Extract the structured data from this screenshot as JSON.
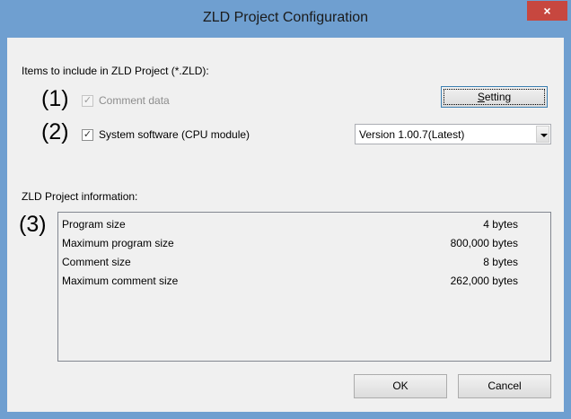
{
  "window": {
    "title": "ZLD Project Configuration",
    "close_glyph": "×"
  },
  "items_group": {
    "label": "Items to include in ZLD Project (*.ZLD):",
    "comment_data": {
      "callout": "(1)",
      "label": "Comment data",
      "checked": true,
      "enabled": false
    },
    "system_software": {
      "callout": "(2)",
      "label": "System software (CPU module)",
      "checked": true,
      "enabled": true
    },
    "setting_button": {
      "label": "Setting",
      "mnemonic": "S"
    },
    "version_select": {
      "selected": "Version 1.00.7(Latest)"
    }
  },
  "info_group": {
    "label": "ZLD Project information:",
    "callout": "(3)",
    "rows": [
      {
        "label": "Program size",
        "value": "4 bytes"
      },
      {
        "label": "Maximum program size",
        "value": "800,000 bytes"
      },
      {
        "label": "Comment size",
        "value": "8 bytes"
      },
      {
        "label": "Maximum comment size",
        "value": "262,000 bytes"
      }
    ]
  },
  "footer": {
    "ok_label": "OK",
    "cancel_label": "Cancel"
  }
}
